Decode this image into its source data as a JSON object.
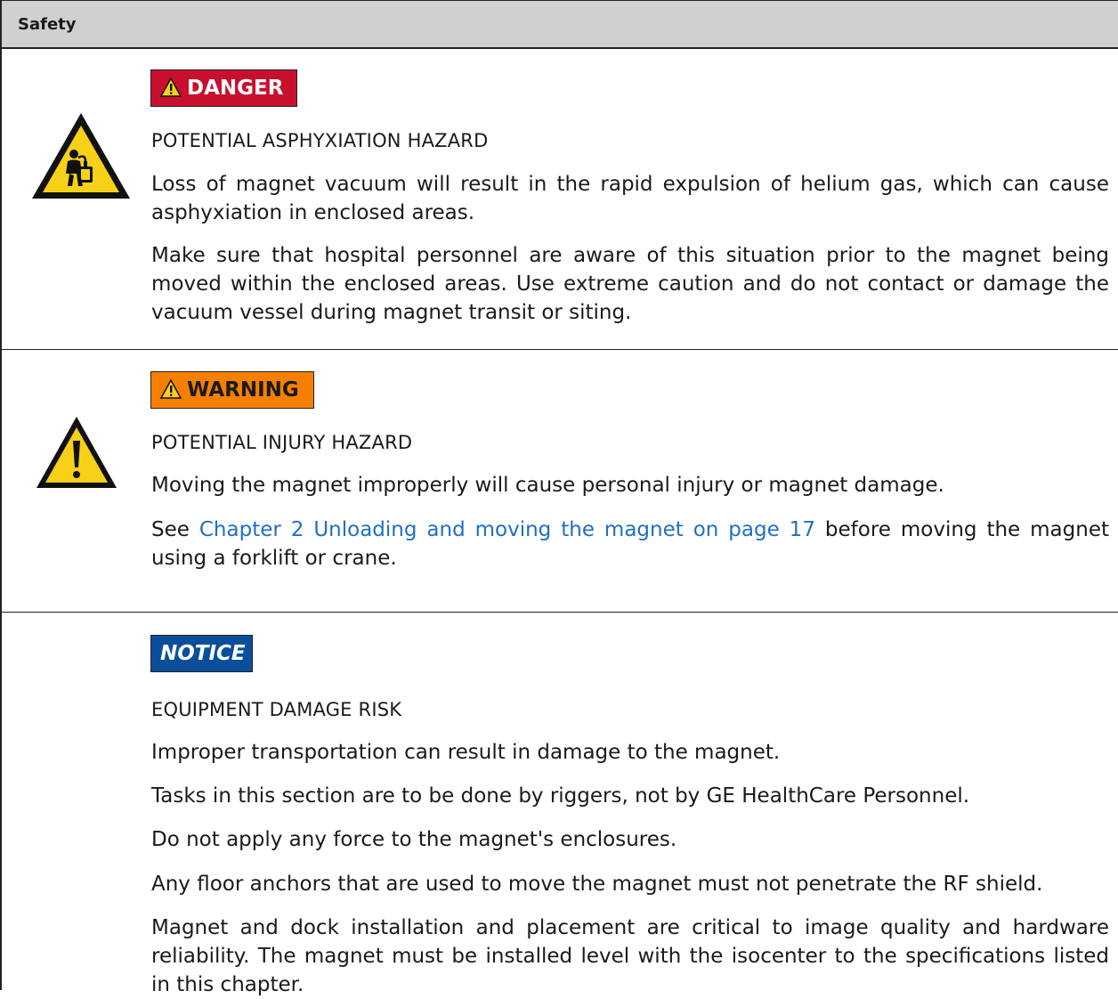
{
  "header": {
    "title": "Safety"
  },
  "danger_block": {
    "badge_label": "DANGER",
    "icon": "asphyxiation-hazard-icon",
    "hazard_title": "POTENTIAL ASPHYXIATION HAZARD",
    "para1": "Loss of magnet vacuum will result in the rapid expulsion of helium gas, which can cause asphyxiation in enclosed areas.",
    "para2": "Make sure that hospital personnel are aware of this situation prior to the magnet being moved within the enclosed areas. Use extreme caution and do not contact or damage the vacuum vessel during magnet transit or siting."
  },
  "warning_block": {
    "badge_label": "WARNING",
    "icon": "general-warning-icon",
    "hazard_title": "POTENTIAL INJURY HAZARD",
    "para1": "Moving the magnet improperly will cause personal injury or magnet damage.",
    "para2_prefix": "See ",
    "para2_link": "Chapter 2 Unloading and moving the magnet on page 17",
    "para2_suffix": " before moving the magnet using a forklift or crane."
  },
  "notice_block": {
    "badge_label": "NOTICE",
    "hazard_title": "EQUIPMENT DAMAGE RISK",
    "para1": "Improper transportation can result in damage to the magnet.",
    "para2": "Tasks in this section are to be done by riggers, not by GE HealthCare Personnel.",
    "para3": "Do not apply any force to the magnet's enclosures.",
    "para4": "Any floor anchors that are used to move the magnet must not penetrate the RF shield.",
    "para5": "Magnet and dock installation and placement are critical to image quality and hardware reliability. The magnet must be installed level with the isocenter to the specifications listed in this chapter."
  },
  "colors": {
    "danger": "#c8102e",
    "warning": "#f77f00",
    "notice": "#0b4f9c",
    "header_bg": "#d0d0d0",
    "link": "#1f6fc5"
  }
}
